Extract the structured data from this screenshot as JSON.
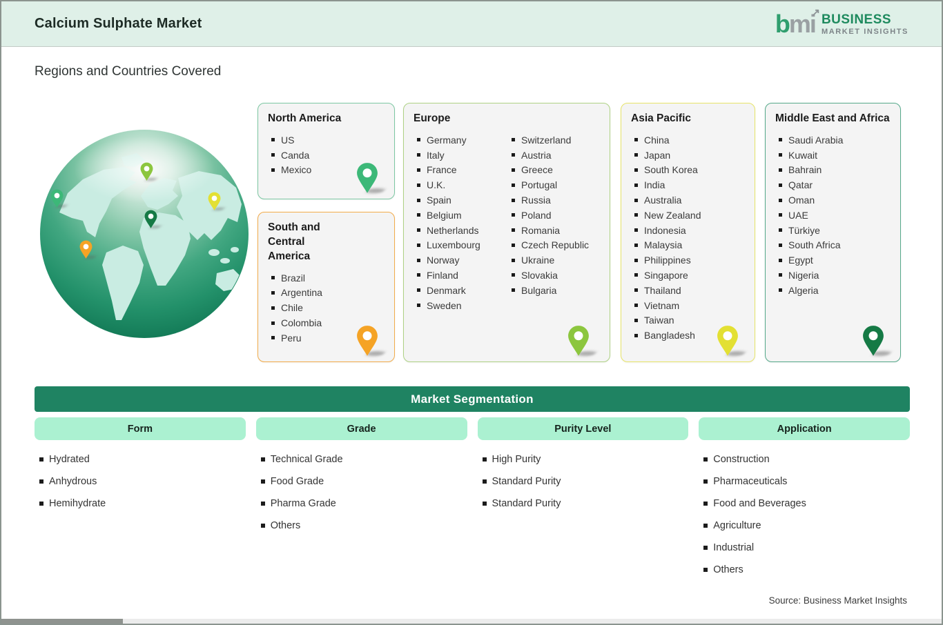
{
  "header": {
    "title": "Calcium Sulphate Market",
    "logo": {
      "mark_b": "b",
      "mark_m": "m",
      "mark_i": "i",
      "line1": "BUSINESS",
      "line2": "MARKET INSIGHTS"
    }
  },
  "section_title": "Regions and Countries Covered",
  "regions": [
    {
      "name": "North America",
      "countries": [
        "US",
        "Canda",
        "Mexico"
      ],
      "pin_color": "#3cb878",
      "border_color": "#7cc7a2"
    },
    {
      "name": "South and Central America",
      "countries": [
        "Brazil",
        "Argentina",
        "Chile",
        "Colombia",
        "Peru"
      ],
      "pin_color": "#f5a325",
      "border_color": "#f2ab4a"
    },
    {
      "name": "Europe",
      "countries_col1": [
        "Germany",
        "Italy",
        "France",
        "U.K.",
        "Spain",
        "Belgium",
        "Netherlands",
        "Luxembourg",
        "Norway",
        "Finland",
        "Denmark",
        "Sweden"
      ],
      "countries_col2": [
        "Switzerland",
        "Austria",
        "Greece",
        "Portugal",
        "Russia",
        "Poland",
        "Romania",
        "Czech Republic",
        "Ukraine",
        "Slovakia",
        "Bulgaria"
      ],
      "pin_color": "#8cc63e",
      "border_color": "#aed284"
    },
    {
      "name": "Asia Pacific",
      "countries": [
        "China",
        "Japan",
        "South Korea",
        "India",
        "Australia",
        "New Zealand",
        "Indonesia",
        "Malaysia",
        "Philippines",
        "Singapore",
        "Thailand",
        "Vietnam",
        "Taiwan",
        "Bangladesh"
      ],
      "pin_color": "#e3e033",
      "border_color": "#e7e468"
    },
    {
      "name": "Middle East and Africa",
      "countries": [
        "Saudi Arabia",
        "Kuwait",
        "Bahrain",
        "Qatar",
        "Oman",
        "UAE",
        "Türkiye",
        "South Africa",
        "Egypt",
        "Nigeria",
        "Algeria"
      ],
      "pin_color": "#157a45",
      "border_color": "#55a98a"
    }
  ],
  "segmentation": {
    "title": "Market Segmentation",
    "columns": [
      {
        "label": "Form",
        "items": [
          "Hydrated",
          "Anhydrous",
          "Hemihydrate"
        ]
      },
      {
        "label": "Grade",
        "items": [
          "Technical Grade",
          "Food Grade",
          "Pharma Grade",
          "Others"
        ]
      },
      {
        "label": "Purity Level",
        "items": [
          "High Purity",
          "Standard Purity",
          "Standard Purity"
        ]
      },
      {
        "label": "Application",
        "items": [
          "Construction",
          "Pharmaceuticals",
          "Food and Beverages",
          "Agriculture",
          "Industrial",
          "Others"
        ]
      }
    ]
  },
  "source": "Source: Business Market Insights",
  "colors": {
    "header_mint": "#dff0e8",
    "banner_green": "#1f8362",
    "chip_mint": "#abf1d1"
  }
}
